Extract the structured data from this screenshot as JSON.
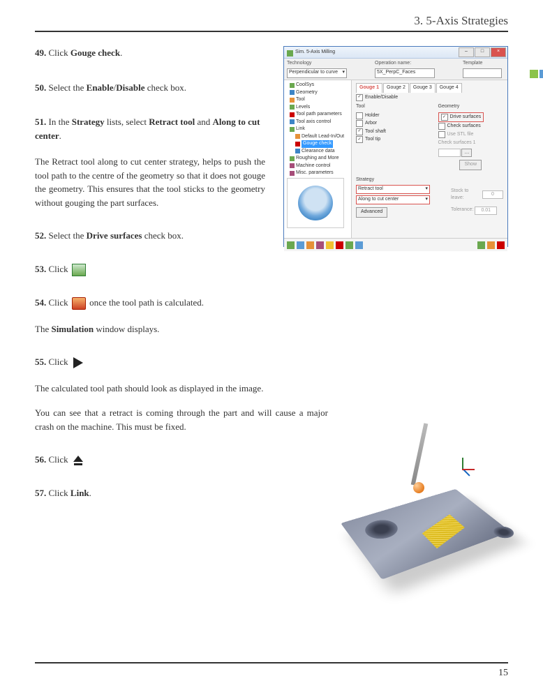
{
  "header": "3. 5-Axis Strategies",
  "page_number": "15",
  "steps": {
    "s49": {
      "num": "49.",
      "pre": "Click ",
      "b": "Gouge check",
      "post": "."
    },
    "s50": {
      "num": "50.",
      "pre": "Select the ",
      "b1": "Enable",
      "mid": "/",
      "b2": "Disable",
      "post": " check box."
    },
    "s51": {
      "num": "51.",
      "pre": "In the ",
      "b1": "Strategy",
      "mid1": " lists, select ",
      "b2": "Retract tool",
      "mid2": " and ",
      "b3": "Along to cut center",
      "post": "."
    },
    "s52": {
      "num": "52.",
      "pre": "Select the ",
      "b": "Drive surfaces",
      "post": " check box."
    },
    "s53": {
      "num": "53.",
      "pre": "Click "
    },
    "s54": {
      "num": "54.",
      "pre": "Click ",
      "post": " once the tool path is calculated."
    },
    "s55": {
      "num": "55.",
      "pre": "Click "
    },
    "s56": {
      "num": "56.",
      "pre": "Click "
    },
    "s57": {
      "num": "57.",
      "pre": "Click ",
      "b": "Link",
      "post": "."
    }
  },
  "paras": {
    "p1": "The Retract tool along to cut center strategy, helps to push the tool path to the centre of the geometry so that it does not gouge the geometry. This ensures that the tool sticks to the geometry without gouging the part surfaces.",
    "p2_pre": "The ",
    "p2_b": "Simulation",
    "p2_post": " window displays.",
    "p3": "The calculated tool path should look as displayed in the image.",
    "p4": "You can see that a retract is coming through the part and will cause a major crash on the machine. This must be fixed."
  },
  "dialog": {
    "title": "Sim. 5-Axis Milling",
    "toolbar": {
      "tech_label": "Technology",
      "tech_value": "Perpendicular to curve",
      "op_label": "Operation name:",
      "op_value": "5X_PerpC_Faces",
      "tmpl_label": "Template"
    },
    "tree": [
      "CoolSys",
      "Geometry",
      "Tool",
      "Levels",
      "Tool path parameters",
      "Tool axis control",
      "Link",
      "Default Lead-In/Out",
      "Gouge check",
      "Clearance data",
      "Roughing and More",
      "Machine control",
      "Misc. parameters"
    ],
    "tabs": [
      "Gouge 1",
      "Gouge 2",
      "Gouge 3",
      "Gouge 4"
    ],
    "enable_label": "Enable/Disable",
    "tool_label": "Tool",
    "holder": "Holder",
    "arbor": "Arbor",
    "toolshaft": "Tool shaft",
    "tooltip": "Tool tip",
    "geom_label": "Geometry",
    "drive_surf": "Drive surfaces",
    "check_surf": "Check surfaces",
    "use_stl": "Use STL file",
    "check_surf1": "Check surfaces 1",
    "show_btn": "Show",
    "strategy_label": "Strategy",
    "strat1": "Retract tool",
    "strat2": "Along to cut center",
    "adv_btn": "Advanced",
    "stock_label": "Stock to leave:",
    "stock_val": "0",
    "tol_label": "Tolerance:",
    "tol_val": "0.01"
  }
}
